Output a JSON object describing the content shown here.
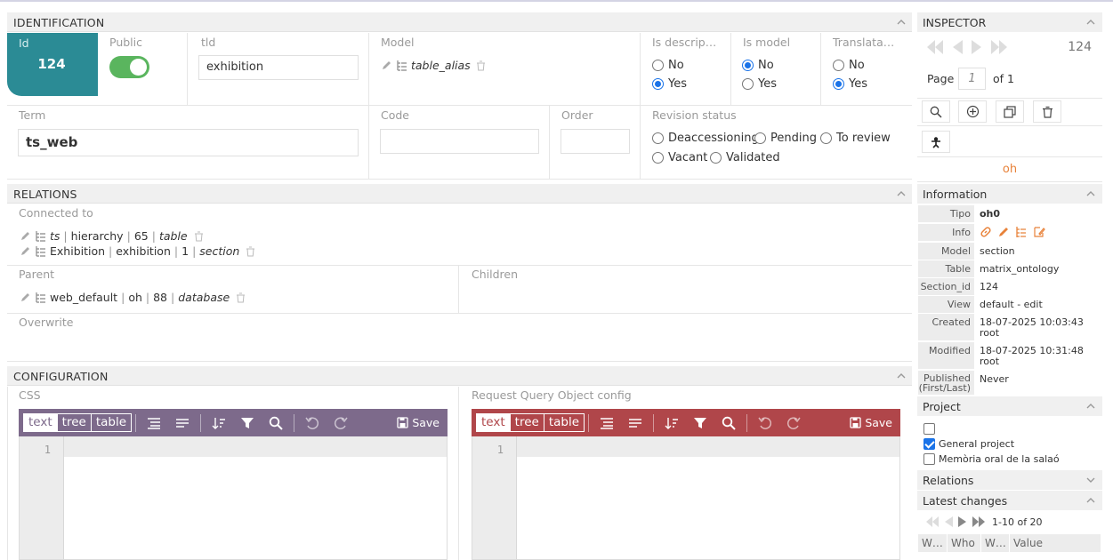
{
  "identification": {
    "title": "IDENTIFICATION",
    "id_label": "Id",
    "id_value": "124",
    "public_label": "Public",
    "tld_label": "tld",
    "tld_value": "exhibition",
    "model_label": "Model",
    "model_value": "table_alias",
    "descriptor_label": "Is descrip…",
    "descriptor_options": [
      "No",
      "Yes"
    ],
    "descriptor_selected": "Yes",
    "ismodel_label": "Is model",
    "ismodel_options": [
      "No",
      "Yes"
    ],
    "ismodel_selected": "No",
    "translatable_label": "Translata…",
    "translatable_options": [
      "No",
      "Yes"
    ],
    "translatable_selected": "Yes",
    "term_label": "Term",
    "term_value": "ts_web",
    "code_label": "Code",
    "code_value": "",
    "order_label": "Order",
    "order_value": "",
    "revision_label": "Revision status",
    "revision_options": [
      "Deaccessioning",
      "Pending",
      "To review",
      "Vacant",
      "Validated"
    ],
    "revision_selected": ""
  },
  "relations": {
    "title": "RELATIONS",
    "connected_label": "Connected to",
    "connected": [
      {
        "a": "ts",
        "b": "hierarchy",
        "c": "65",
        "d": "table"
      },
      {
        "a": "Exhibition",
        "b": "exhibition",
        "c": "1",
        "d": "section"
      }
    ],
    "parent_label": "Parent",
    "parent": {
      "a": "web_default",
      "b": "oh",
      "c": "88",
      "d": "database"
    },
    "children_label": "Children",
    "overwrite_label": "Overwrite"
  },
  "configuration": {
    "title": "CONFIGURATION",
    "css_label": "CSS",
    "rqo_label": "Request Query Object config",
    "mode_buttons": [
      "text",
      "tree",
      "table"
    ],
    "save_label": "Save",
    "line_number": "1",
    "css_color": "#7d6a8b",
    "rqo_color": "#b0464a"
  },
  "inspector": {
    "title": "INSPECTOR",
    "record_id": "124",
    "page_label": "Page",
    "page_value": "1",
    "of_label": "of 1",
    "tipo_highlight": "oh",
    "information_title": "Information",
    "info": [
      {
        "k": "Tipo",
        "v": "oh0"
      },
      {
        "k": "Info",
        "v": ""
      },
      {
        "k": "Model",
        "v": "section"
      },
      {
        "k": "Table",
        "v": "matrix_ontology"
      },
      {
        "k": "Section_id",
        "v": "124"
      },
      {
        "k": "View",
        "v": "default - edit"
      },
      {
        "k": "Created",
        "v": "18-07-2025 10:03:43",
        "v2": "root"
      },
      {
        "k": "Modified",
        "v": "18-07-2025 10:31:48",
        "v2": "root"
      },
      {
        "k": "Published",
        "k2": "(First/Last)",
        "v": "Never"
      }
    ],
    "project_title": "Project",
    "projects": [
      {
        "label": "",
        "checked": false
      },
      {
        "label": "General project",
        "checked": true
      },
      {
        "label": "Memòria oral de la salaó",
        "checked": false
      }
    ],
    "relations_title": "Relations",
    "latest_title": "Latest changes",
    "latest_range": "1-10 of 20",
    "latest_cols": [
      "W…",
      "Who",
      "W…",
      "Value"
    ],
    "accent": "#e8823a"
  }
}
